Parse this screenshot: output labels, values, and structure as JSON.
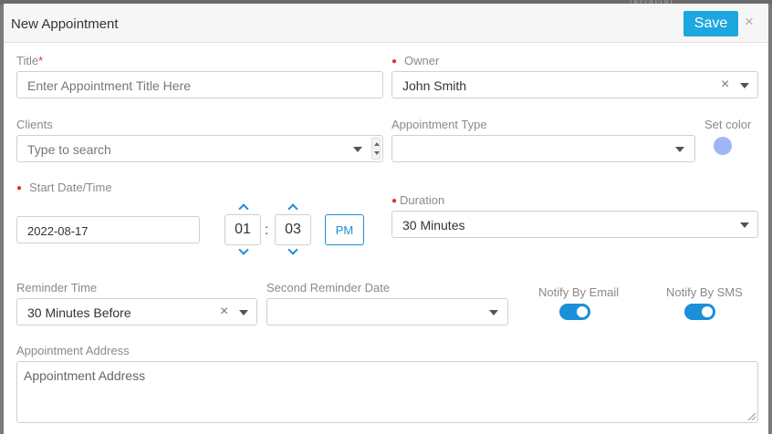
{
  "backdrop": {
    "time_fragment": "00:00:00"
  },
  "dialog": {
    "title": "New Appointment",
    "save_label": "Save",
    "close_glyph": "×"
  },
  "title_field": {
    "label": "Title",
    "required_mark": "*",
    "placeholder": "Enter Appointment Title Here"
  },
  "owner": {
    "label": "Owner",
    "value": "John Smith"
  },
  "clients": {
    "label": "Clients",
    "placeholder": "Type to search"
  },
  "appointment_type": {
    "label": "Appointment Type",
    "value": ""
  },
  "set_color": {
    "label": "Set color",
    "color": "#9db7f5"
  },
  "start": {
    "label": "Start Date/Time",
    "date": "2022-08-17",
    "hour": "01",
    "minute": "03",
    "separator": ":",
    "meridiem": "PM"
  },
  "duration": {
    "label": "Duration",
    "value": "30 Minutes"
  },
  "reminder_time": {
    "label": "Reminder Time",
    "value": "30 Minutes Before"
  },
  "second_reminder": {
    "label": "Second Reminder Date",
    "value": ""
  },
  "notify_email": {
    "label": "Notify By Email",
    "enabled": true
  },
  "notify_sms": {
    "label": "Notify By SMS",
    "enabled": true
  },
  "address": {
    "label": "Appointment Address",
    "placeholder": "Appointment Address"
  },
  "colors": {
    "accent": "#1b8fd8",
    "save_button": "#1da7e0",
    "required": "#e0245e"
  },
  "icons": [
    "close-icon",
    "clear-icon",
    "caret-down-icon",
    "spinner-icon",
    "chevron-up-icon",
    "chevron-down-icon",
    "required-dot-icon",
    "resize-grip-icon"
  ]
}
